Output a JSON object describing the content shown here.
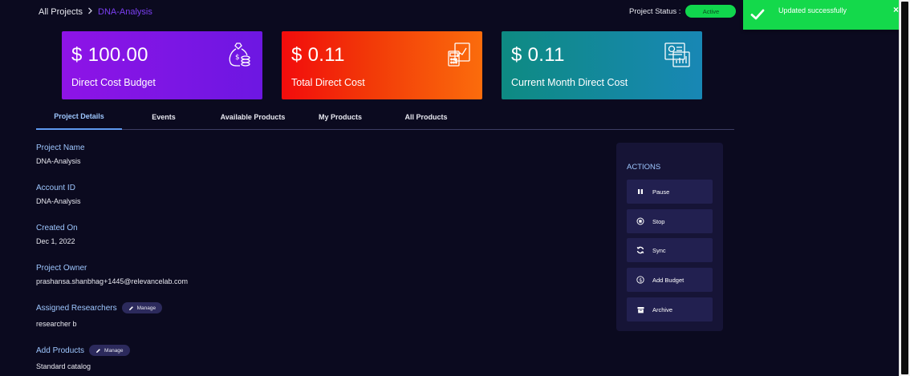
{
  "breadcrumb": {
    "root": "All Projects",
    "separator": ">",
    "current": "DNA-Analysis"
  },
  "status": {
    "label": "Project Status :",
    "value": "Active"
  },
  "toast": {
    "message": "Updated successfully",
    "close": "×"
  },
  "cards": [
    {
      "amount": "$ 100.00",
      "label": "Direct Cost Budget",
      "icon": "money-bag-icon"
    },
    {
      "amount": "$ 0.11",
      "label": "Total Direct Cost",
      "icon": "calculator-icon"
    },
    {
      "amount": "$ 0.11",
      "label": "Current Month Direct Cost",
      "icon": "invoice-icon"
    }
  ],
  "tabs": [
    "Project Details",
    "Events",
    "Available Products",
    "My Products",
    "All Products"
  ],
  "details": {
    "project_name": {
      "label": "Project Name",
      "value": "DNA-Analysis"
    },
    "account_id": {
      "label": "Account ID",
      "value": "DNA-Analysis"
    },
    "created_on": {
      "label": "Created On",
      "value": "Dec 1, 2022"
    },
    "project_owner": {
      "label": "Project Owner",
      "value": "prashansa.shanbhag+1445@relevancelab.com"
    },
    "researchers": {
      "label": "Assigned Researchers",
      "manage": "Manage",
      "value": "researcher b"
    },
    "products": {
      "label": "Add Products",
      "manage": "Manage",
      "value": "Standard catalog"
    }
  },
  "actions": {
    "title": "ACTIONS",
    "buttons": [
      {
        "label": "Pause",
        "icon": "pause-icon"
      },
      {
        "label": "Stop",
        "icon": "stop-icon"
      },
      {
        "label": "Sync",
        "icon": "sync-icon"
      },
      {
        "label": "Add Budget",
        "icon": "dollar-icon"
      },
      {
        "label": "Archive",
        "icon": "archive-icon"
      }
    ]
  },
  "colors": {
    "background": "#0b0a1f",
    "accent_blue": "#9ec7ff",
    "status_green": "#10d64d",
    "toast_green": "#14d94b",
    "breadcrumb_current": "#7b3ff2"
  }
}
